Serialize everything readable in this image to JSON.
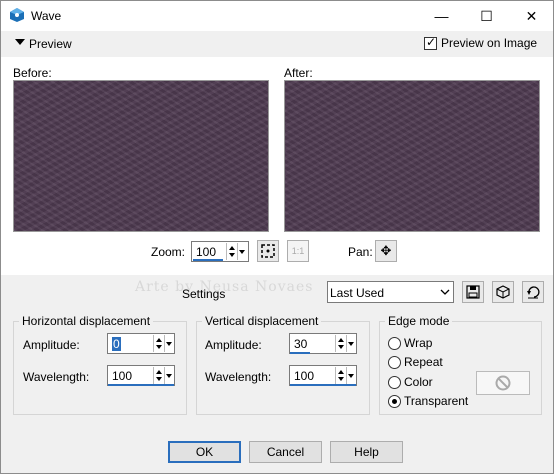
{
  "window": {
    "title": "Wave",
    "app_icon": "psp-icon"
  },
  "controls": {
    "minimize": "—",
    "maximize": "☐",
    "close": "✕"
  },
  "preview": {
    "toggle_label": "Preview",
    "preview_on_image_label": "Preview on Image",
    "preview_on_image_checked": true
  },
  "panes": {
    "before_label": "Before:",
    "after_label": "After:"
  },
  "zoom": {
    "label": "Zoom:",
    "value": "100"
  },
  "pan": {
    "label": "Pan:"
  },
  "watermark": "Arte by Neusa Novaes",
  "settings": {
    "label": "Settings",
    "preset": "Last Used"
  },
  "horizontal": {
    "title": "Horizontal displacement",
    "amplitude_label": "Amplitude:",
    "amplitude": "0",
    "wavelength_label": "Wavelength:",
    "wavelength": "100"
  },
  "vertical": {
    "title": "Vertical displacement",
    "amplitude_label": "Amplitude:",
    "amplitude": "30",
    "wavelength_label": "Wavelength:",
    "wavelength": "100"
  },
  "edge": {
    "title": "Edge mode",
    "options": [
      "Wrap",
      "Repeat",
      "Color",
      "Transparent"
    ],
    "selected": "Transparent"
  },
  "buttons": {
    "ok": "OK",
    "cancel": "Cancel",
    "help": "Help"
  },
  "colors": {
    "preview_fill": "#4e3a50",
    "accent": "#2a6ebd"
  }
}
